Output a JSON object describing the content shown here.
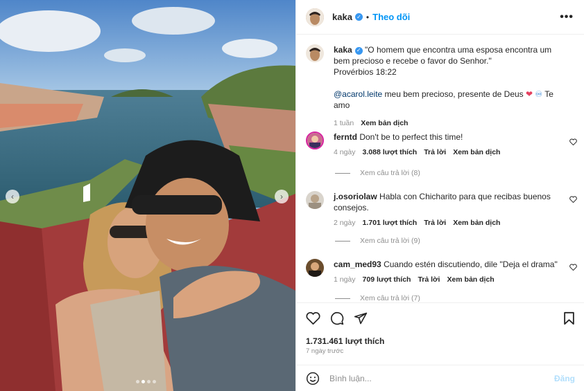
{
  "post": {
    "username": "kaka",
    "separator": "•",
    "follow_label": "Theo dõi",
    "more_label": "•••",
    "verified_icon": "verified-badge-icon"
  },
  "caption": {
    "username": "kaka",
    "text_1": "\"O homem que encontra uma esposa encontra um bem precioso e recebe o favor do Senhor.\"",
    "text_2": "Provérbios 18:22",
    "mention": "@acarol.leite",
    "text_3": " meu bem precioso, presente de Deus ",
    "heart_emoji": "❤",
    "infinity_emoji": "♾",
    "text_4": " Te amo",
    "time": "1 tuần",
    "translate": "Xem bản dịch"
  },
  "comments": [
    {
      "username": "ferntd",
      "text": "Don't be to perfect this time!",
      "time": "4 ngày",
      "likes": "3.088 lượt thích",
      "reply": "Trả lời",
      "translate": "Xem bản dịch",
      "replies": "Xem câu trả lời (8)"
    },
    {
      "username": "j.osoriolaw",
      "text": "Habla con Chicharito para que recibas buenos consejos.",
      "time": "2 ngày",
      "likes": "1.701 lượt thích",
      "reply": "Trả lời",
      "translate": "Xem bản dịch",
      "replies": "Xem câu trả lời (9)"
    },
    {
      "username": "cam_med93",
      "text": "Cuando estén discutiendo, dile \"Deja el drama\"",
      "time": "1 ngày",
      "likes": "709 lượt thích",
      "reply": "Trả lời",
      "translate": "Xem bản dịch",
      "replies": "Xem câu trả lời (7)"
    }
  ],
  "actions": {
    "likes": "1.731.461 lượt thích",
    "posted": "7 ngày trước"
  },
  "composer": {
    "placeholder": "Bình luận...",
    "post_label": "Đăng"
  },
  "carousel": {
    "prev_label": "‹",
    "next_label": "›",
    "slide_count": 4,
    "active_slide": 2
  },
  "colors": {
    "accent": "#0095f6",
    "link": "#00376b",
    "muted": "#8e8e8e",
    "post_disabled": "#b2dffc"
  }
}
